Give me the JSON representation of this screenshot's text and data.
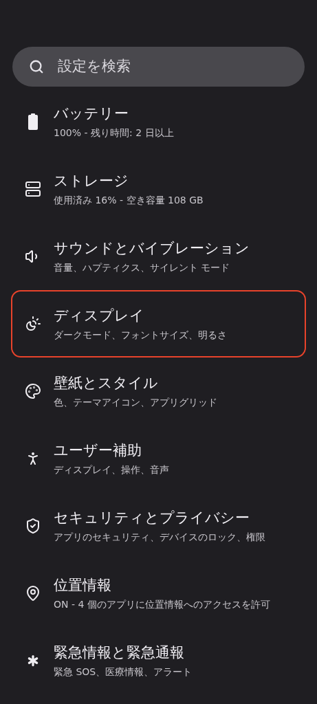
{
  "search": {
    "placeholder": "設定を検索"
  },
  "items": [
    {
      "title": "バッテリー",
      "subtitle": "100% - 残り時間: 2 日以上",
      "highlighted": false
    },
    {
      "title": "ストレージ",
      "subtitle": "使用済み 16% - 空き容量 108 GB",
      "highlighted": false
    },
    {
      "title": "サウンドとバイブレーション",
      "subtitle": "音量、ハプティクス、サイレント モード",
      "highlighted": false
    },
    {
      "title": "ディスプレイ",
      "subtitle": "ダークモード、フォントサイズ、明るさ",
      "highlighted": true
    },
    {
      "title": "壁紙とスタイル",
      "subtitle": "色、テーマアイコン、アプリグリッド",
      "highlighted": false
    },
    {
      "title": "ユーザー補助",
      "subtitle": "ディスプレイ、操作、音声",
      "highlighted": false
    },
    {
      "title": "セキュリティとプライバシー",
      "subtitle": "アプリのセキュリティ、デバイスのロック、権限",
      "highlighted": false
    },
    {
      "title": "位置情報",
      "subtitle": "ON - 4 個のアプリに位置情報へのアクセスを許可",
      "highlighted": false
    },
    {
      "title": "緊急情報と緊急通報",
      "subtitle": "緊急 SOS、医療情報、アラート",
      "highlighted": false
    }
  ]
}
